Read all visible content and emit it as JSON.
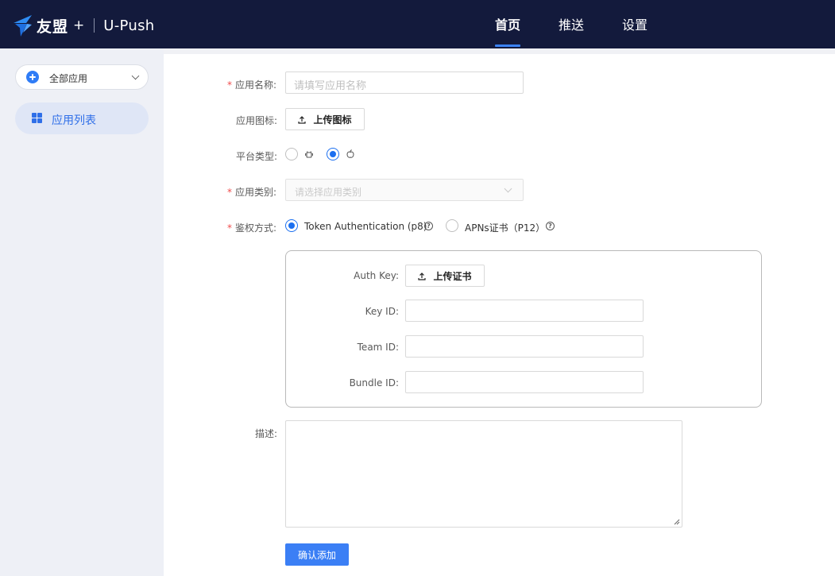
{
  "header": {
    "brand": "友盟",
    "brand_plus": "+",
    "product": "U-Push",
    "nav": [
      {
        "label": "首页",
        "active": true
      },
      {
        "label": "推送",
        "active": false
      },
      {
        "label": "设置",
        "active": false
      }
    ],
    "accent_color": "#3b82f6"
  },
  "sidebar": {
    "app_select_label": "全部应用",
    "menu": [
      {
        "label": "应用列表",
        "icon": "grid-icon",
        "active": true
      }
    ]
  },
  "form": {
    "app_name": {
      "label": "应用名称:",
      "required": true,
      "placeholder": "请填写应用名称",
      "value": ""
    },
    "app_icon": {
      "label": "应用图标:",
      "button": "上传图标"
    },
    "platform": {
      "label": "平台类型:",
      "options": [
        {
          "icon": "android-icon",
          "checked": false
        },
        {
          "icon": "apple-icon",
          "checked": true
        }
      ]
    },
    "app_category": {
      "label": "应用类别:",
      "required": true,
      "placeholder": "请选择应用类别"
    },
    "auth_method": {
      "label": "鉴权方式:",
      "required": true,
      "options": [
        {
          "label": "Token Authentication (p8)",
          "checked": true
        },
        {
          "label": "APNs证书（P12）",
          "checked": false
        }
      ]
    },
    "cert": {
      "auth_key": {
        "label": "Auth Key:",
        "button": "上传证书"
      },
      "key_id": {
        "label": "Key ID:",
        "value": ""
      },
      "team_id": {
        "label": "Team ID:",
        "value": ""
      },
      "bundle_id": {
        "label": "Bundle ID:",
        "value": ""
      }
    },
    "description": {
      "label": "描述:",
      "value": ""
    },
    "submit": "确认添加"
  }
}
